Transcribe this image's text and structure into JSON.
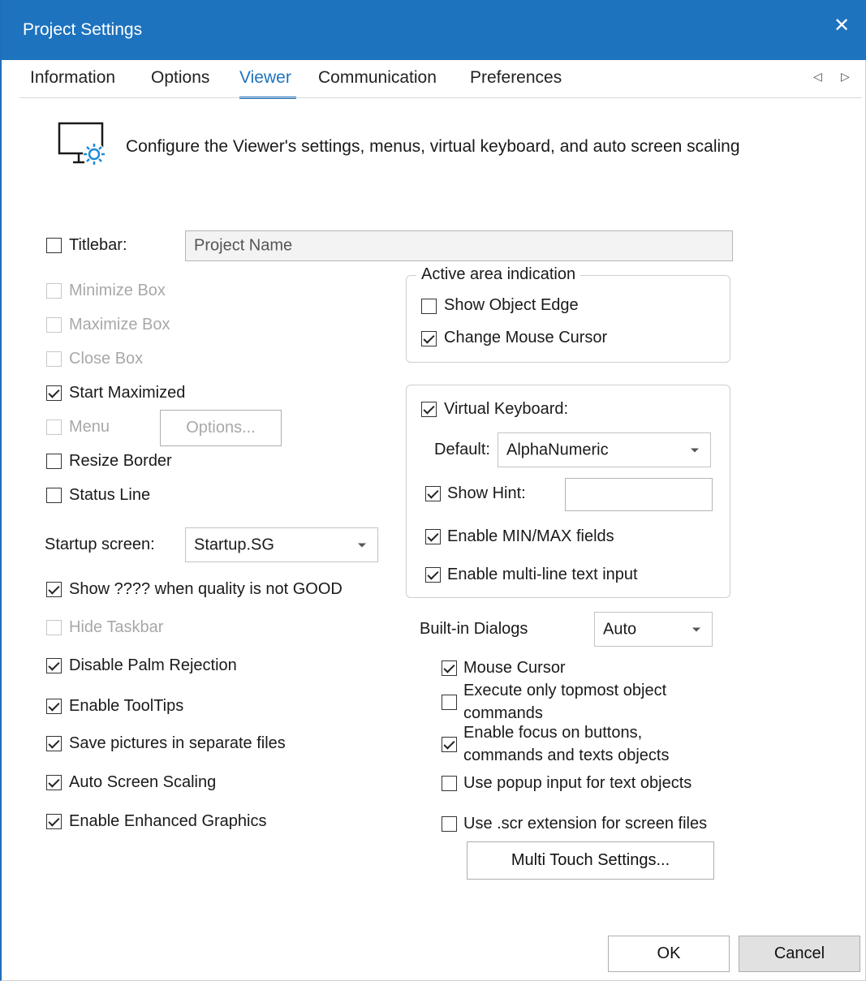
{
  "window": {
    "title": "Project Settings",
    "close_glyph": "✕"
  },
  "tabs": [
    {
      "label": "Information",
      "active": false
    },
    {
      "label": "Options",
      "active": false
    },
    {
      "label": "Viewer",
      "active": true
    },
    {
      "label": "Communication",
      "active": false
    },
    {
      "label": "Preferences",
      "active": false
    }
  ],
  "tab_nav": {
    "prev_glyph": "◁",
    "next_glyph": "▷"
  },
  "header": {
    "icon": "monitor-gear-icon",
    "text": "Configure the Viewer's settings, menus, virtual keyboard, and auto screen scaling"
  },
  "left": {
    "titlebar": {
      "label": "Titlebar:",
      "checked": false,
      "value": "Project Name"
    },
    "minimize_box": {
      "label": "Minimize Box",
      "checked": false,
      "disabled": true
    },
    "maximize_box": {
      "label": "Maximize Box",
      "checked": false,
      "disabled": true
    },
    "close_box": {
      "label": "Close Box",
      "checked": false,
      "disabled": true
    },
    "start_maximized": {
      "label": "Start Maximized",
      "checked": true
    },
    "menu": {
      "label": "Menu",
      "checked": false,
      "disabled": true,
      "options_button": "Options..."
    },
    "resize_border": {
      "label": "Resize Border",
      "checked": false
    },
    "status_line": {
      "label": "Status Line",
      "checked": false
    },
    "startup_screen": {
      "label": "Startup screen:",
      "value": "Startup.SG"
    },
    "show_quality": {
      "label": "Show ???? when quality is not GOOD",
      "checked": true
    },
    "hide_taskbar": {
      "label": "Hide Taskbar",
      "checked": false,
      "disabled": true
    },
    "disable_palm": {
      "label": "Disable Palm Rejection",
      "checked": true
    },
    "enable_tooltips": {
      "label": "Enable ToolTips",
      "checked": true
    },
    "save_pictures": {
      "label": "Save pictures in separate files",
      "checked": true
    },
    "auto_scaling": {
      "label": "Auto Screen Scaling",
      "checked": true
    },
    "enhanced_graphics": {
      "label": "Enable Enhanced Graphics",
      "checked": true
    }
  },
  "active_area": {
    "title": "Active area indication",
    "show_object_edge": {
      "label": "Show Object Edge",
      "checked": false
    },
    "change_mouse_cursor": {
      "label": "Change Mouse Cursor",
      "checked": true
    }
  },
  "virtual_keyboard": {
    "label": "Virtual Keyboard:",
    "checked": true,
    "default_label": "Default:",
    "default_value": "AlphaNumeric",
    "show_hint": {
      "label": "Show Hint:",
      "checked": true,
      "value": ""
    },
    "min_max": {
      "label": "Enable MIN/MAX fields",
      "checked": true
    },
    "multiline": {
      "label": "Enable multi-line text input",
      "checked": true
    }
  },
  "builtin_dialogs": {
    "label": "Built-in Dialogs",
    "value": "Auto"
  },
  "right_options": {
    "mouse_cursor": {
      "label": "Mouse Cursor",
      "checked": true
    },
    "execute_topmost_1": "Execute only topmost object",
    "execute_topmost_2": "commands",
    "execute_topmost_checked": false,
    "enable_focus_1": "Enable focus on buttons,",
    "enable_focus_2": "commands and texts objects",
    "enable_focus_checked": true,
    "popup_input": {
      "label": "Use popup input for text objects",
      "checked": false
    },
    "scr_extension": {
      "label": "Use .scr extension for screen files",
      "checked": false
    },
    "multi_touch_button": "Multi Touch Settings..."
  },
  "footer": {
    "ok": "OK",
    "cancel": "Cancel"
  },
  "colors": {
    "accent": "#1e73be",
    "disabled_text": "#a8a8a8"
  }
}
